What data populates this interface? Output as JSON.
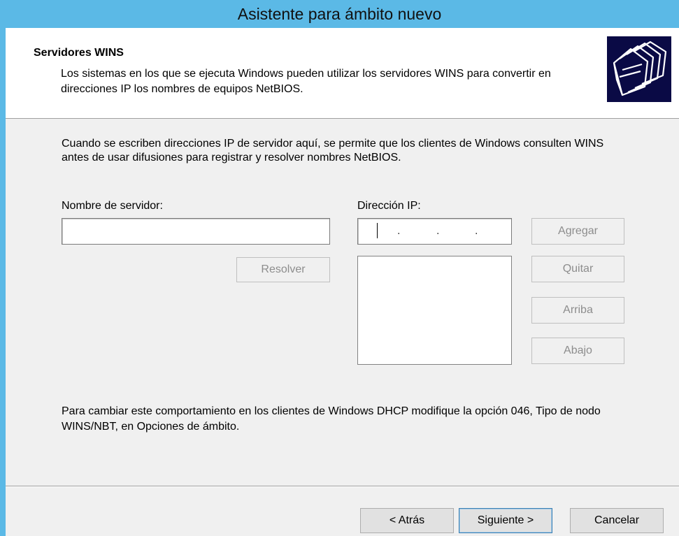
{
  "window": {
    "title": "Asistente para ámbito nuevo"
  },
  "header": {
    "title": "Servidores WINS",
    "description": "Los sistemas en los que se ejecuta Windows pueden utilizar los servidores WINS para convertir en direcciones IP los nombres de equipos NetBIOS.",
    "icon": "folder-stack-icon"
  },
  "content": {
    "intro": "Cuando se escriben direcciones IP de servidor aquí, se permite que los clientes de Windows consulten WINS antes de usar difusiones para registrar y resolver nombres NetBIOS.",
    "server_name_label": "Nombre de servidor:",
    "server_name_value": "",
    "ip_label": "Dirección IP:",
    "ip_value": ". . .",
    "resolve_button": "Resolver",
    "ip_list": [],
    "buttons": {
      "add": "Agregar",
      "remove": "Quitar",
      "up": "Arriba",
      "down": "Abajo"
    },
    "footnote": "Para cambiar este comportamiento en los clientes de Windows DHCP modifique la opción 046, Tipo de nodo WINS/NBT, en Opciones de ámbito."
  },
  "footer": {
    "back": "< Atrás",
    "next": "Siguiente >",
    "cancel": "Cancelar"
  },
  "colors": {
    "titlebar": "#5bb9e6",
    "dialog_background": "#f0f0f0",
    "header_background": "#ffffff",
    "icon_background": "#0a0a45",
    "disabled_text": "#8d8d8d"
  }
}
